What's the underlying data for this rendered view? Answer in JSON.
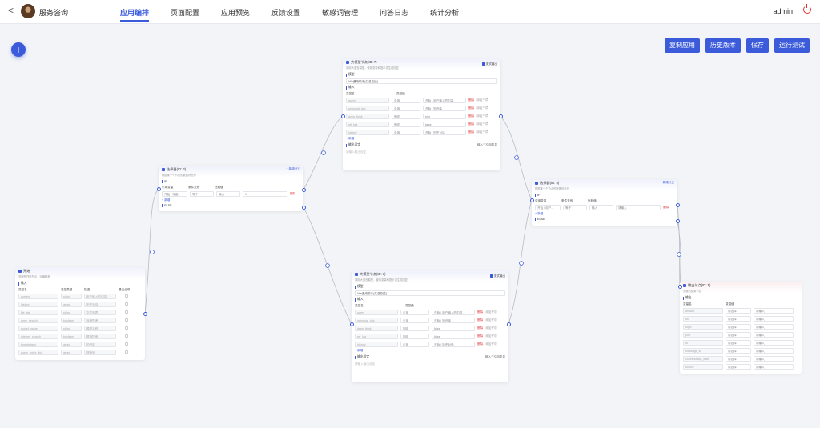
{
  "header": {
    "back": "<",
    "app_title": "服务咨询",
    "tabs": [
      "应用编排",
      "页面配置",
      "应用预览",
      "反馈设置",
      "敏感词管理",
      "问答日志",
      "统计分析"
    ],
    "active_tab": 0,
    "user": "admin"
  },
  "fab": "+",
  "actions": [
    "复制应用",
    "历史版本",
    "保存",
    "运行测试"
  ],
  "nodes": {
    "start": {
      "title": "开始",
      "subtitle": "流程的开始节点，可编辑参",
      "section": "输入",
      "headers": [
        "变量名",
        "变量类型",
        "描述",
        "是否必填"
      ],
      "rows": [
        [
          "content",
          "string",
          "用户输入的内容"
        ],
        [
          "history",
          "array",
          "历史对话"
        ],
        [
          "file_ids",
          "string",
          "文件列表"
        ],
        [
          "deep_search",
          "boolean",
          "深度思考"
        ],
        [
          "model_name",
          "string",
          "模型名称"
        ],
        [
          "internet_search",
          "boolean",
          "联网搜索"
        ],
        [
          "knowledges",
          "array",
          "知识库"
        ],
        [
          "query_index_list",
          "array",
          "搜索列"
        ]
      ]
    },
    "cond1": {
      "title": "选择器(ID: 2)",
      "subtitle": "根据某一个节点的数据状态分",
      "add_branch": "+ 新增分支",
      "if_label": "IF",
      "headers": [
        "引用变量",
        "条件关系",
        "比较值"
      ],
      "row": [
        "开始 / 深度...",
        "等于",
        "输入",
        "1"
      ],
      "delete": "删除",
      "add": "+ 新增",
      "else_label": "ELSE"
    },
    "llm1": {
      "title": "大模型节点(ID: 7)",
      "subtitle": "调用大语言模型，使用变量和提示词生成回复",
      "stream_label": "流式输出",
      "model_section": "模型",
      "model_value": "Idle通用助手(汇总总结)",
      "input_section": "输入",
      "headers": [
        "变量名",
        "变量值"
      ],
      "rows": [
        [
          "query",
          "引用",
          "开始 / 用户输入的内容"
        ],
        [
          "personal_doc",
          "引用",
          "开始 / 知识库"
        ],
        [
          "deep_think",
          "固定",
          "true"
        ],
        [
          "ref_tag",
          "固定",
          "false"
        ],
        [
          "history",
          "引用",
          "开始 / 历史对话"
        ]
      ],
      "delete": "删除",
      "ctl": "添加子项",
      "add": "+ 新增",
      "output_section": "输出设定",
      "output_hint": "输入“/”引用变量",
      "output_placeholder": "请输入输出设定"
    },
    "llm2": {
      "title": "大模型节点(ID: 3)",
      "subtitle": "调用大语言模型，使用变量和提示词生成回复",
      "stream_label": "流式输出",
      "model_section": "模型",
      "model_value": "Idle通用助手(汇总总结)",
      "input_section": "输入",
      "headers": [
        "变量名",
        "变量值"
      ],
      "rows": [
        [
          "query",
          "引用",
          "开始 / 用户输入的内容"
        ],
        [
          "personal_doc",
          "引用",
          "开始 / 知识库"
        ],
        [
          "deep_think",
          "固定",
          "false"
        ],
        [
          "ref_tag",
          "固定",
          "false"
        ],
        [
          "history",
          "引用",
          "开始 / 历史对话"
        ]
      ],
      "delete": "删除",
      "ctl": "添加子项",
      "add": "+ 新增",
      "output_section": "输出设定",
      "output_hint": "输入“/”引用变量",
      "output_placeholder": "请输入输出设定"
    },
    "cond2": {
      "title": "选择器(ID: 4)",
      "subtitle": "根据某一个节点的数据状态分",
      "add_branch": "+ 新增分支",
      "if_label": "IF",
      "headers": [
        "引用变量",
        "条件关系",
        "比较值"
      ],
      "row": [
        "开始 / 用户...",
        "等于",
        "输入",
        "请输入"
      ],
      "delete": "删除",
      "add": "+ 新增",
      "else_label": "ELSE"
    },
    "out": {
      "title": "输出节点(ID: 5)",
      "subtitle": "流程的结束节点",
      "section": "输出",
      "headers": [
        "变量名",
        "变量值"
      ],
      "rows": [
        [
          "answer",
          "请选择",
          "请输入"
        ],
        [
          "url",
          "请选择",
          "请输入"
        ],
        [
          "topic",
          "请选择",
          "请输入"
        ],
        [
          "port",
          "请选择",
          "请输入"
        ],
        [
          "id",
          "请选择",
          "请输入"
        ],
        [
          "message_id",
          "请选择",
          "请输入"
        ],
        [
          "conversation_date",
          "请选择",
          "请输入"
        ],
        [
          "source",
          "请选择",
          "请输入"
        ]
      ]
    }
  }
}
